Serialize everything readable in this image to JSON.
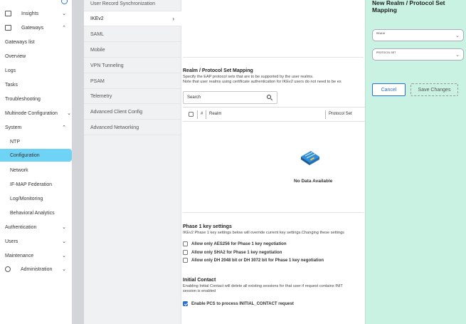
{
  "nav": {
    "items": [
      {
        "label": "Insights",
        "icon": "monitor-icon",
        "chev": "⌄"
      },
      {
        "label": "Gateways",
        "icon": "gateway-icon",
        "chev": "⌃"
      },
      {
        "label": "Gateways list"
      },
      {
        "label": "Overview"
      },
      {
        "label": "Logs"
      },
      {
        "label": "Tasks"
      },
      {
        "label": "Troubleshooting"
      },
      {
        "label": "Multinode Configuration",
        "chev": "⌄"
      },
      {
        "label": "System",
        "chev": "⌃"
      },
      {
        "label": "NTP"
      },
      {
        "label": "Configuration"
      },
      {
        "label": "Network"
      },
      {
        "label": "IF-MAP Federation"
      },
      {
        "label": "Log/Monitoring"
      },
      {
        "label": "Behavioral Analytics"
      },
      {
        "label": "Authentication",
        "chev": "⌄"
      },
      {
        "label": "Users",
        "chev": "⌄"
      },
      {
        "label": "Maintenance",
        "chev": "⌄"
      },
      {
        "label": "Administration",
        "icon": "admin-icon",
        "chev": "⌄"
      }
    ]
  },
  "submenu": {
    "items": [
      {
        "label": "User Record Synchronization"
      },
      {
        "label": "IKEv2",
        "arrow": "›"
      },
      {
        "label": "SAML"
      },
      {
        "label": "Mobile"
      },
      {
        "label": "VPN Tunneling"
      },
      {
        "label": "PSAM"
      },
      {
        "label": "Telemetry"
      },
      {
        "label": "Advanced Client Config"
      },
      {
        "label": "Advanced Networking"
      }
    ]
  },
  "realm_section": {
    "title": "Realm / Protocol Set Mapping",
    "desc1": "Specify the EAP protocol sets that are to be supported by the user realms.",
    "desc2": "Note that user realms using certificate authentication for IKEv2 users do not need to be es",
    "search_placeholder": "Search",
    "columns": [
      "#",
      "Realm",
      "Protocol Set"
    ],
    "empty_text": "No Data Available"
  },
  "phase1": {
    "title": "Phase 1 key settings",
    "desc": "IKEv2 Phase 1 key settings below will override current key settings.Changing these settings",
    "options": [
      {
        "label": "Allow only AES256 for Phase 1 key negotiation",
        "checked": false
      },
      {
        "label": "Allow only SHA2 for Phase 1 key negotiation",
        "checked": false
      },
      {
        "label": "Allow only DH 2048 bit or DH 3072 bit for Phase 1 key negotiation",
        "checked": false
      }
    ]
  },
  "initial_contact": {
    "title": "Initial Contact",
    "desc1": "Enabling Initial Contact will delete all existing sessions for that user if request contains INIT",
    "desc2": "session is enabled",
    "option": {
      "label": "Enable PCS to process INITIAL_CONTACT request",
      "checked": true
    }
  },
  "panel": {
    "title": "New Realm / Protocol Set Mapping",
    "realm_label": "REALM",
    "protocol_label": "PROTOCOL SET",
    "cancel_label": "Cancel",
    "save_label": "Save Changes"
  },
  "colors": {
    "active_nav": "#6fd3f5",
    "panel_bg": "#c9f2e3",
    "accent": "#2a6fd6"
  }
}
